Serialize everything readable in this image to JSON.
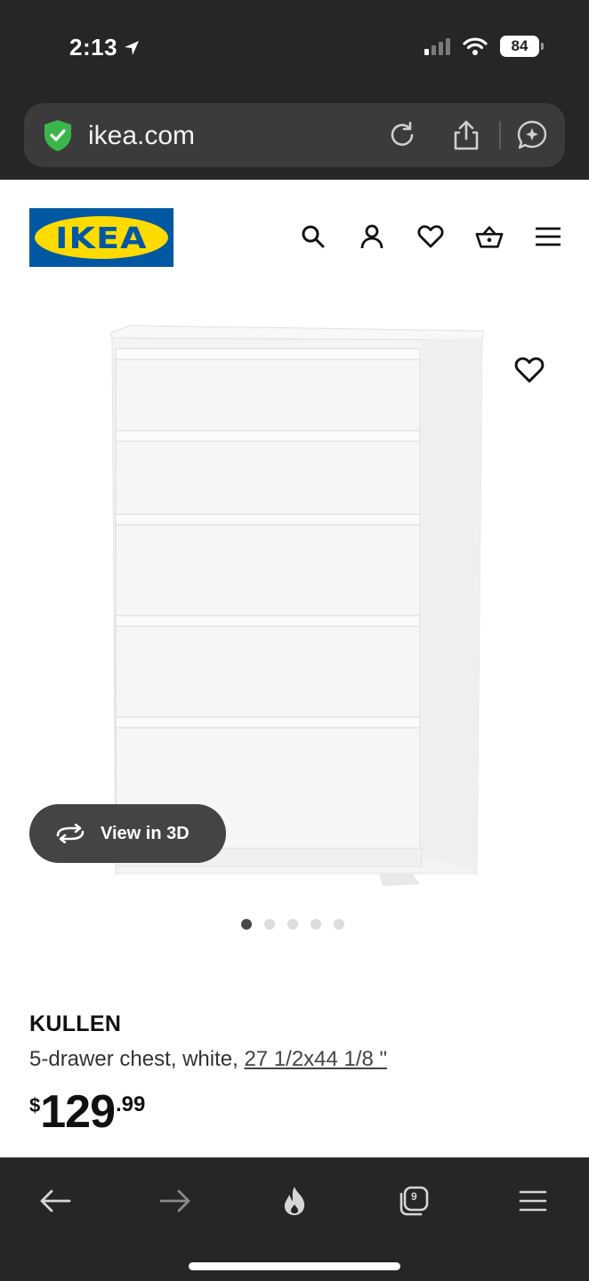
{
  "status_bar": {
    "time": "2:13",
    "battery": "84"
  },
  "browser": {
    "url": "ikea.com"
  },
  "brand": {
    "logo_text": "IKEA",
    "blue": "#0058a3",
    "yellow": "#ffdb00"
  },
  "header": {
    "icons": [
      "search-icon",
      "account-icon",
      "heart-icon",
      "basket-icon",
      "menu-icon"
    ]
  },
  "product": {
    "view_3d_label": "View in 3D",
    "image_count": 5,
    "active_image": 1,
    "name": "KULLEN",
    "description": "5-drawer chest, white,",
    "measurement": "27 1/2x44 1/8 \"",
    "price": {
      "currency": "$",
      "integer": "129",
      "decimal": ".99"
    }
  },
  "bottom_bar": {
    "tabs_count": "9",
    "icons": [
      "back-icon",
      "forward-icon",
      "flame-icon",
      "tabs-icon",
      "menu-icon"
    ]
  }
}
